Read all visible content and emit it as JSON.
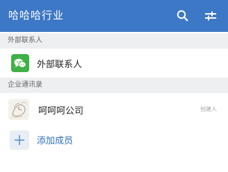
{
  "header": {
    "title": "哈哈哈行业",
    "search_icon": "search-icon",
    "settings_icon": "sliders-icon",
    "color": "#3d78c6"
  },
  "sections": {
    "external": "外部联系人",
    "enterprise": "企业通讯录"
  },
  "external_row": {
    "label": "外部联系人",
    "icon": "wechat-icon",
    "icon_color": "#40b147"
  },
  "company_row": {
    "name": "呵呵呵公司",
    "tag": "创建人",
    "avatar": "sketch-avatar"
  },
  "add_row": {
    "label": "添加成员",
    "icon": "plus-icon",
    "accent": "#2c6fbd"
  }
}
